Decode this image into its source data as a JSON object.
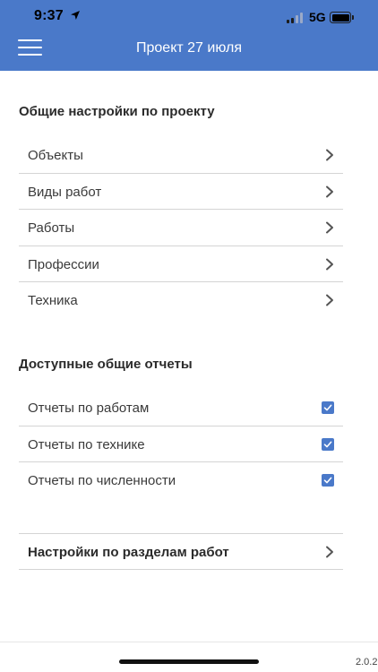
{
  "status_bar": {
    "time": "9:37",
    "network": "5G",
    "icons": [
      "location-arrow-icon",
      "signal-bars-icon",
      "battery-icon"
    ]
  },
  "header": {
    "title": "Проект 27 июля",
    "menu_icon": "hamburger-menu-icon",
    "background_color": "#4a79c9"
  },
  "general_settings": {
    "title": "Общие настройки по проекту",
    "items": [
      {
        "label": "Объекты",
        "icon": "chevron-right-icon"
      },
      {
        "label": "Виды работ",
        "icon": "chevron-right-icon"
      },
      {
        "label": "Работы",
        "icon": "chevron-right-icon"
      },
      {
        "label": "Профессии",
        "icon": "chevron-right-icon"
      },
      {
        "label": "Техника",
        "icon": "chevron-right-icon"
      }
    ]
  },
  "reports": {
    "title": "Доступные общие отчеты",
    "items": [
      {
        "label": "Отчеты по работам",
        "checked": true
      },
      {
        "label": "Отчеты по технике",
        "checked": true
      },
      {
        "label": "Отчеты по численности",
        "checked": true
      }
    ],
    "checkbox_color": "#4a79c9"
  },
  "section_settings": {
    "label": "Настройки по разделам работ",
    "icon": "chevron-right-icon"
  },
  "version": "2.0.2"
}
